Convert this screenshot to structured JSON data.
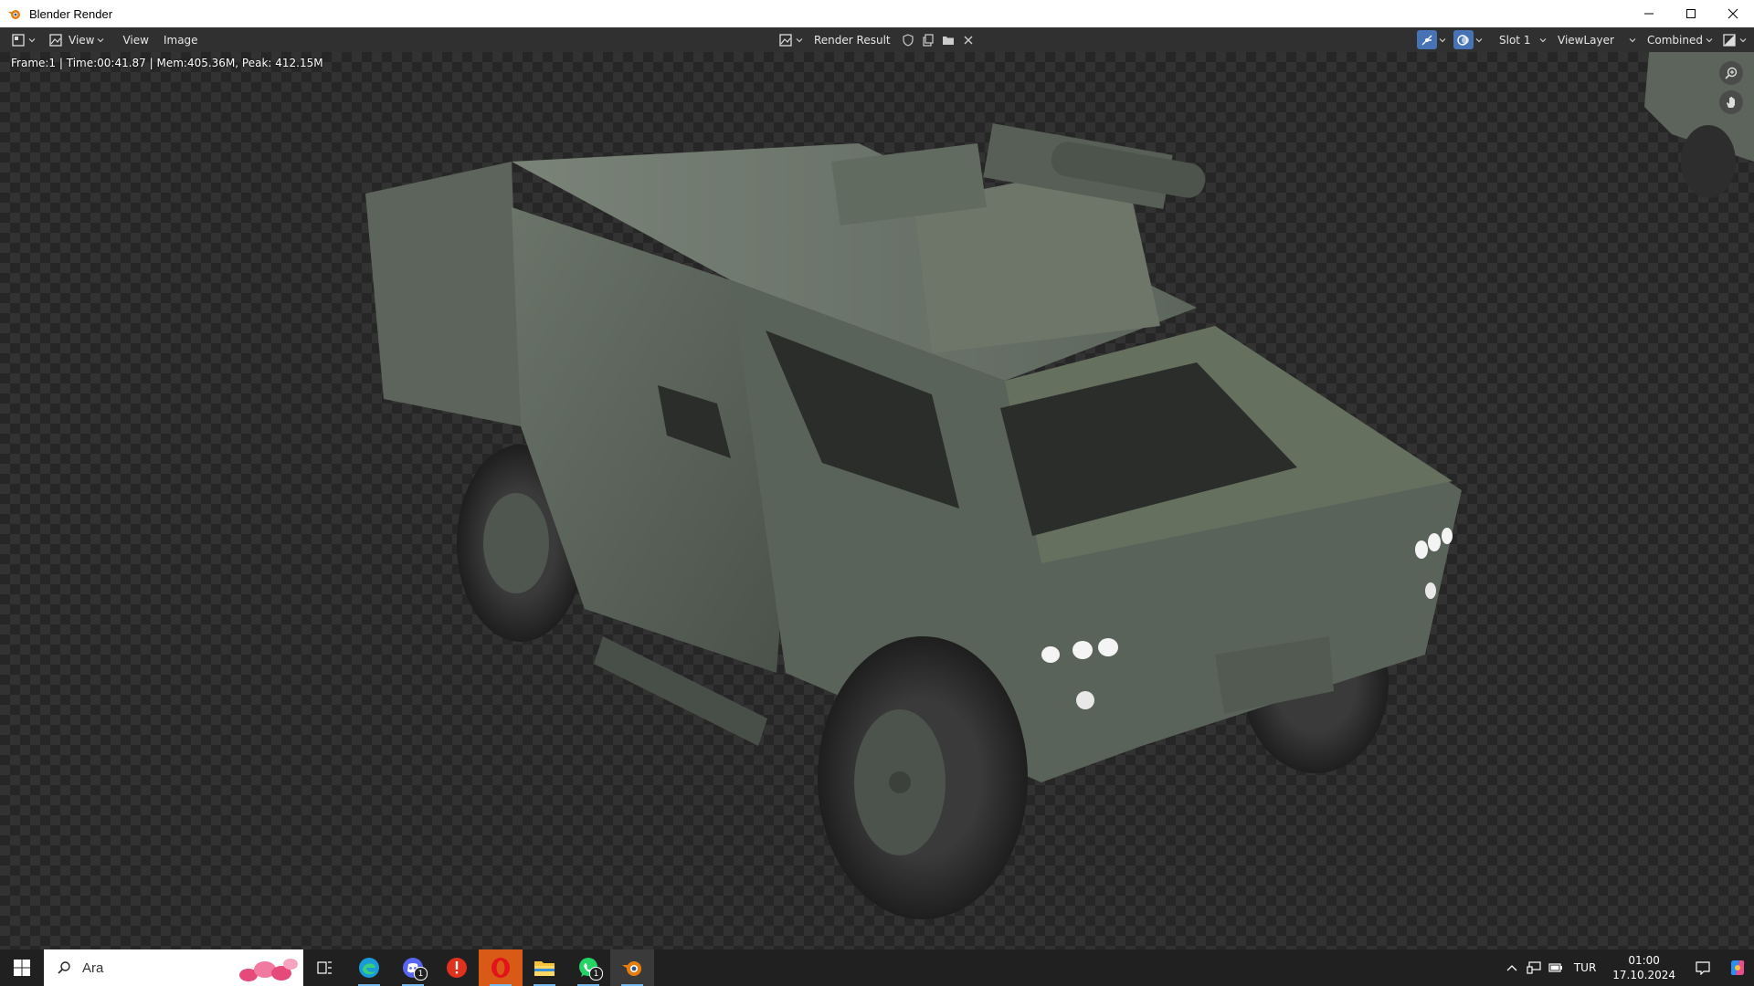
{
  "window": {
    "title": "Blender Render"
  },
  "header": {
    "menus": [
      "View",
      "View",
      "Image"
    ],
    "image_name": "Render Result",
    "slot": "Slot 1",
    "view_layer": "ViewLayer",
    "pass": "Combined"
  },
  "viewport": {
    "status": "Frame:1 | Time:00:41.87 | Mem:405.36M, Peak: 412.15M"
  },
  "taskbar": {
    "search_placeholder": "Ara",
    "discord_badge": "1",
    "whatsapp_badge": "1",
    "language": "TUR",
    "time": "01:00",
    "date": "17.10.2024"
  },
  "colors": {
    "accent": "#4772b3",
    "header_bg": "#303030",
    "vehicle_body": "#5a6359"
  }
}
